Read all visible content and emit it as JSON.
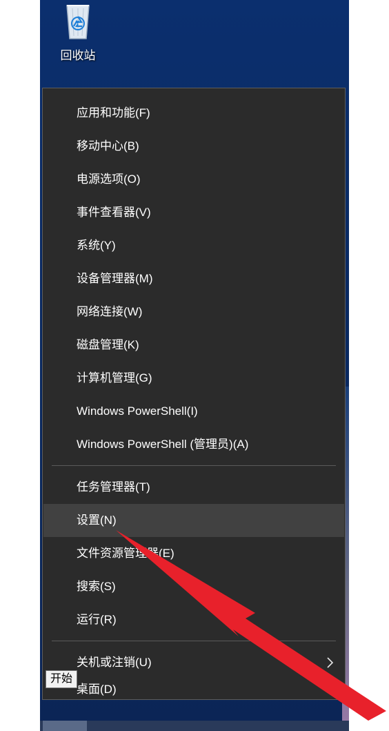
{
  "desktop": {
    "recycle_bin_label": "回收站"
  },
  "menu": {
    "group1": [
      {
        "label": "应用和功能(F)"
      },
      {
        "label": "移动中心(B)"
      },
      {
        "label": "电源选项(O)"
      },
      {
        "label": "事件查看器(V)"
      },
      {
        "label": "系统(Y)"
      },
      {
        "label": "设备管理器(M)"
      },
      {
        "label": "网络连接(W)"
      },
      {
        "label": "磁盘管理(K)"
      },
      {
        "label": "计算机管理(G)"
      },
      {
        "label": "Windows PowerShell(I)"
      },
      {
        "label": "Windows PowerShell (管理员)(A)"
      }
    ],
    "group2": [
      {
        "label": "任务管理器(T)"
      },
      {
        "label": "设置(N)",
        "highlighted": true
      },
      {
        "label": "文件资源管理器(E)"
      },
      {
        "label": "搜索(S)"
      },
      {
        "label": "运行(R)"
      }
    ],
    "group3": [
      {
        "label": "关机或注销(U)",
        "has_submenu": true,
        "submenu_icon": "chevron-right-icon"
      },
      {
        "label": "桌面(D)"
      }
    ]
  },
  "tooltip": {
    "text": "开始"
  },
  "annotation": {
    "arrow_color": "#e8212b",
    "highlight_color": "#414141"
  }
}
